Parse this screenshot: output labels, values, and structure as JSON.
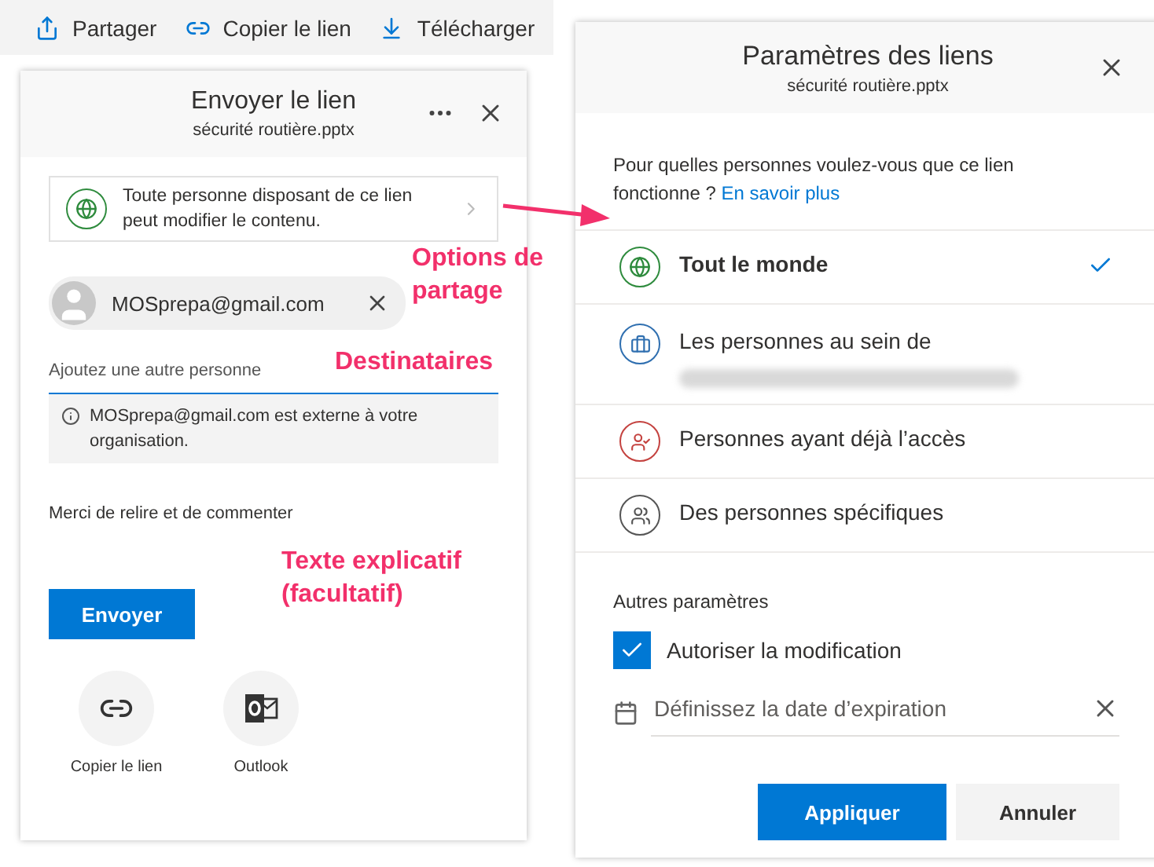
{
  "toolbar": {
    "items": [
      {
        "label": "Partager",
        "kind": "share"
      },
      {
        "label": "Copier le lien",
        "kind": "link"
      },
      {
        "label": "Télécharger",
        "kind": "download"
      }
    ]
  },
  "send_dialog": {
    "title": "Envoyer le lien",
    "file": "sécurité routière.pptx",
    "link_summary": "Toute personne disposant de ce lien peut modifier le contenu.",
    "recipient": "MOSprepa@gmail.com",
    "add_person": {
      "placeholder": "Ajoutez une autre personne"
    },
    "external_notice": "MOSprepa@gmail.com est externe à votre organisation.",
    "message": "Merci de relire et de commenter",
    "send_button": "Envoyer",
    "share_options": [
      {
        "label": "Copier le lien",
        "kind": "link"
      },
      {
        "label": "Outlook",
        "kind": "outlook"
      }
    ]
  },
  "link_settings": {
    "title": "Paramètres des liens",
    "file": "sécurité routière.pptx",
    "question": "Pour quelles personnes voulez-vous que ce lien fonctionne ?",
    "learn_more": "En savoir plus",
    "options": [
      {
        "label": "Tout le monde",
        "kind": "everyone",
        "selected": true
      },
      {
        "label": "Les personnes au sein de",
        "kind": "organization",
        "selected": false,
        "redacted": true
      },
      {
        "label": "Personnes ayant déjà l’accès",
        "kind": "existing",
        "selected": false
      },
      {
        "label": "Des personnes spécifiques",
        "kind": "specific",
        "selected": false
      }
    ],
    "other_settings": "Autres paramètres",
    "allow_edit": {
      "label": "Autoriser la modification",
      "checked": true
    },
    "expiration": {
      "placeholder": "Définissez la date d’expiration"
    },
    "buttons": [
      {
        "label": "Appliquer",
        "primary": true
      },
      {
        "label": "Annuler",
        "primary": false
      }
    ]
  },
  "annotations": [
    {
      "text": "Options de partage"
    },
    {
      "text": "Destinataires"
    },
    {
      "text": "Texte explicatif (facultatif)"
    }
  ]
}
